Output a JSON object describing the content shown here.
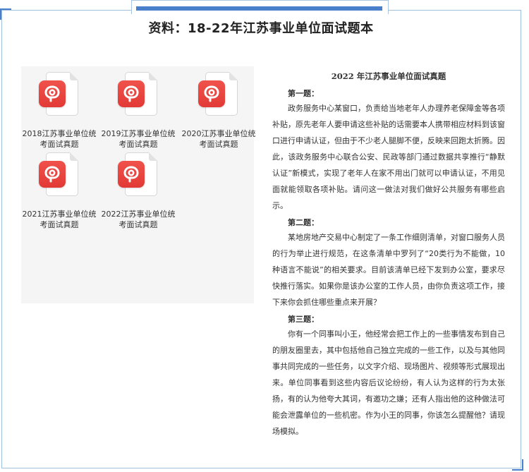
{
  "title": "资料：18-22年江苏事业单位面试题本",
  "files": [
    {
      "label": "2018江苏事业单位统考面试真题",
      "icon": "wps-pdf-icon"
    },
    {
      "label": "2019江苏事业单位统考面试真题",
      "icon": "wps-pdf-icon"
    },
    {
      "label": "2020江苏事业单位统考面试真题",
      "icon": "wps-pdf-icon"
    },
    {
      "label": "2021江苏事业单位统考面试真题",
      "icon": "wps-pdf-icon"
    },
    {
      "label": "2022江苏事业单位统考面试真题",
      "icon": "wps-pdf-icon"
    }
  ],
  "article": {
    "heading": "2022 年江苏事业单位面试真题",
    "questions": [
      {
        "label": "第一题：",
        "text": "政务服务中心某窗口，负责给当地老年人办理养老保障金等各项补贴，原先老年人要申请这些补贴的话需要本人携带相应材料到该窗口进行申请认证，但由于不少老人腿脚不便，反映来回跑太折腾。因此，该政务服务中心联合公安、民政等部门通过数据共享推行“静默认证”新模式，实现了老年人在家不用出门就可以申请认证，不用见面就能领取各项补贴。请问这一做法对我们做好公共服务有哪些启示。"
      },
      {
        "label": "第二题：",
        "text": "某地房地产交易中心制定了一条工作细则清单，对窗口服务人员的行为举止进行规范，在这条清单中罗列了“20类行为不能做，10种语言不能说”的相关要求。目前该清单已经下发到办公室，要求尽快推行落实。如果你是该办公室的工作人员，由你负责这项工作，接下来你会抓住哪些重点来开展？"
      },
      {
        "label": "第三题：",
        "text": "你有一个同事叫小王，他经常会把工作上的一些事情发布到自己的朋友圈里去，其中包括他自己独立完成的一些工作，以及与其他同事共同完成的一些任务，以文字介绍、现场图片、视频等形式展现出来。单位同事看到这些内容后议论纷纷，有人认为这样的行为太张扬，有的认为他夸大其词，有邀功之嫌；还有人指出他的这种做法可能会泄露单位的一些机密。作为小王的同事，你该怎么提醒他？请现场模拟。"
      }
    ]
  },
  "colors": {
    "accent": "#4a7fcb",
    "icon_red": "#e8403b",
    "panel_bg": "#f5f5f5"
  }
}
